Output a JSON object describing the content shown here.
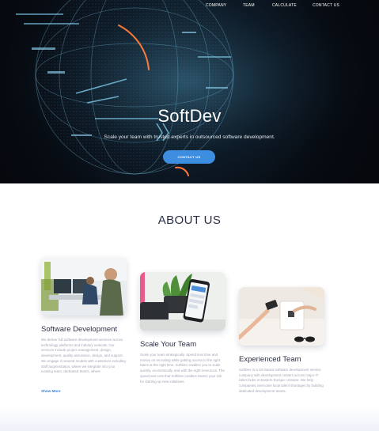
{
  "nav": {
    "items": [
      "COMPANY",
      "TEAM",
      "CALCULATE",
      "CONTACT US"
    ]
  },
  "hero": {
    "brand": "SoftDev",
    "tagline": "Scale your team with trusted experts in outsourced software development.",
    "cta_label": "CONTACT US"
  },
  "about": {
    "title": "ABOUT US",
    "cards": [
      {
        "title": "Software Development",
        "text": "We deliver full software development services across technology platforms and industry verticals. Our services include project management, design, development, quality assurance, design, and support. We engage in several models with customers including staff augmentation, where we integrate into your existing team, dedicated teams, where",
        "link": "Show More"
      },
      {
        "title": "Scale Your Team",
        "text": "Scale your team strategically. Spend less time and money on recruiting while getting access to the right talent at the right time. SoftDev enables you to scale quickly, economically, and with the right resources. The speed and cost that SoftDev enables lowers your risk for starting up new initiatives."
      },
      {
        "title": "Experienced Team",
        "text": "SoftDev is a US-based software development service company with development centers across major IT talent hubs in Eastern Europe: Ukraine. We help companies overcome local talent shortages by building dedicated development teams."
      }
    ]
  }
}
